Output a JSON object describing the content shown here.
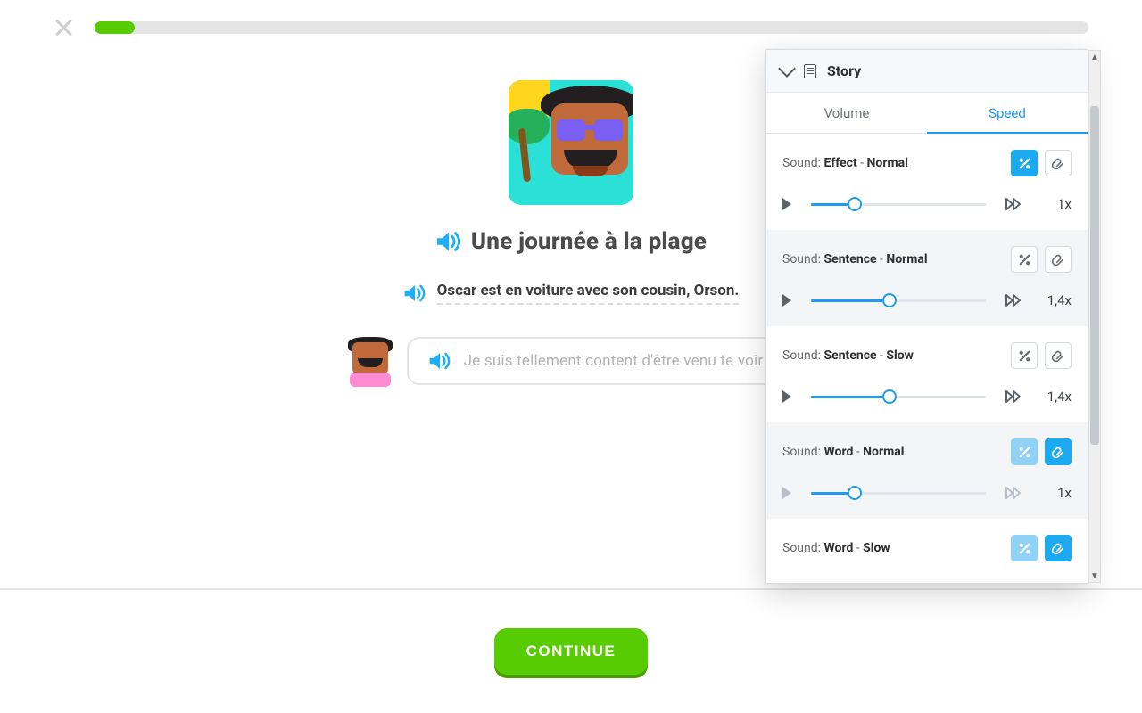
{
  "header": {
    "progress_pct": 4
  },
  "story": {
    "title": "Une journée à la plage",
    "sentence": "Oscar est en voiture avec son cousin, Orson.",
    "bubble": "Je suis tellement content d'être venu te voir !"
  },
  "footer": {
    "continue_label": "CONTINUE"
  },
  "panel": {
    "title": "Story",
    "tabs": {
      "volume": "Volume",
      "speed": "Speed",
      "active": "speed"
    },
    "sound_label": "Sound:",
    "rows": [
      {
        "name": "Effect",
        "mode": "Normal",
        "value_text": "1x",
        "fill_pct": 25,
        "pct_btn": "primary",
        "clip_btn": "plain",
        "alt": false,
        "disabled": false
      },
      {
        "name": "Sentence",
        "mode": "Normal",
        "value_text": "1,4x",
        "fill_pct": 45,
        "pct_btn": "plain",
        "clip_btn": "plain",
        "alt": true,
        "disabled": false
      },
      {
        "name": "Sentence",
        "mode": "Slow",
        "value_text": "1,4x",
        "fill_pct": 45,
        "pct_btn": "plain",
        "clip_btn": "plain",
        "alt": false,
        "disabled": false
      },
      {
        "name": "Word",
        "mode": "Normal",
        "value_text": "1x",
        "fill_pct": 25,
        "pct_btn": "faded",
        "clip_btn": "primary",
        "alt": true,
        "disabled": true
      },
      {
        "name": "Word",
        "mode": "Slow",
        "value_text": "",
        "fill_pct": 0,
        "pct_btn": "faded",
        "clip_btn": "primary",
        "alt": false,
        "disabled": false,
        "truncated": true
      }
    ]
  }
}
